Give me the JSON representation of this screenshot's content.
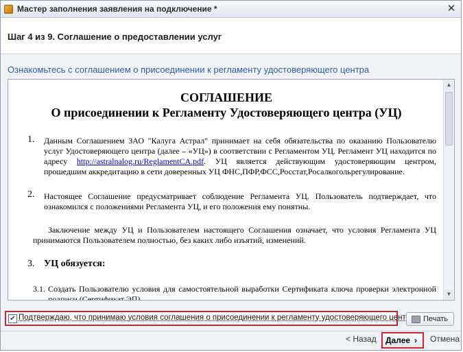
{
  "window": {
    "title": "Мастер заполнения заявления на подключение *",
    "close_glyph": "✕"
  },
  "header": {
    "step_title": "Шаг 4 из 9. Соглашение о предоставлении услуг"
  },
  "instruction": "Ознакомьтесь с соглашением о присоединении к регламенту удостоверяющего центра",
  "document": {
    "title": "СОГЛАШЕНИЕ",
    "subtitle": "О присоединении к Регламенту  Удостоверяющего центра (УЦ)",
    "item1_num": "1.",
    "item1_text": "Данным Соглашением ЗАО \"Калуга Астрал\" принимает на себя обязательства по оказанию Пользователю услуг Удостоверяющего центра (далее – «УЦ») в соответствии с Регламентом УЦ. Регламент УЦ находится по адресу",
    "item1_link": "http://astralnalog.ru/ReglamentCA.pdf",
    "item1_text2": ". УЦ является действующим удостоверяющим центром, прошедшим аккредитацию в сети доверенных УЦ ФНС,ПФР,ФСС,Росстат,Росалкогольрегулирование.",
    "item2_num": "2.",
    "item2_text": "Настоящее Соглашение предусматривает соблюдение Регламента УЦ. Пользователь подтверждает, что ознакомился с положениями Регламента УЦ, и его положения ему понятны.",
    "paragraph": "Заключение между УЦ и Пользователем настоящего Соглашения означает, что условия Регламента УЦ принимаются Пользователем полностью, без каких либо изъятий, изменений.",
    "item3_num": "3.",
    "item3_heading": "УЦ обязуется:",
    "item31_num": "3.1.",
    "item31_text": "Создать Пользователю условия для самостоятельной выработки Сертификата ключа проверки электронной подписи (Сертификат ЭП)."
  },
  "agree": {
    "checked_glyph": "✔",
    "label": "Подтверждаю, что принимаю условия соглашения о присоединении к регламенту удостоверяющего центра"
  },
  "buttons": {
    "print": "Печать",
    "back": "< Назад",
    "next": "Далее",
    "next_arrow": "›",
    "cancel": "Отмена"
  },
  "scrollbar": {
    "up": "▲",
    "down": "▼"
  }
}
